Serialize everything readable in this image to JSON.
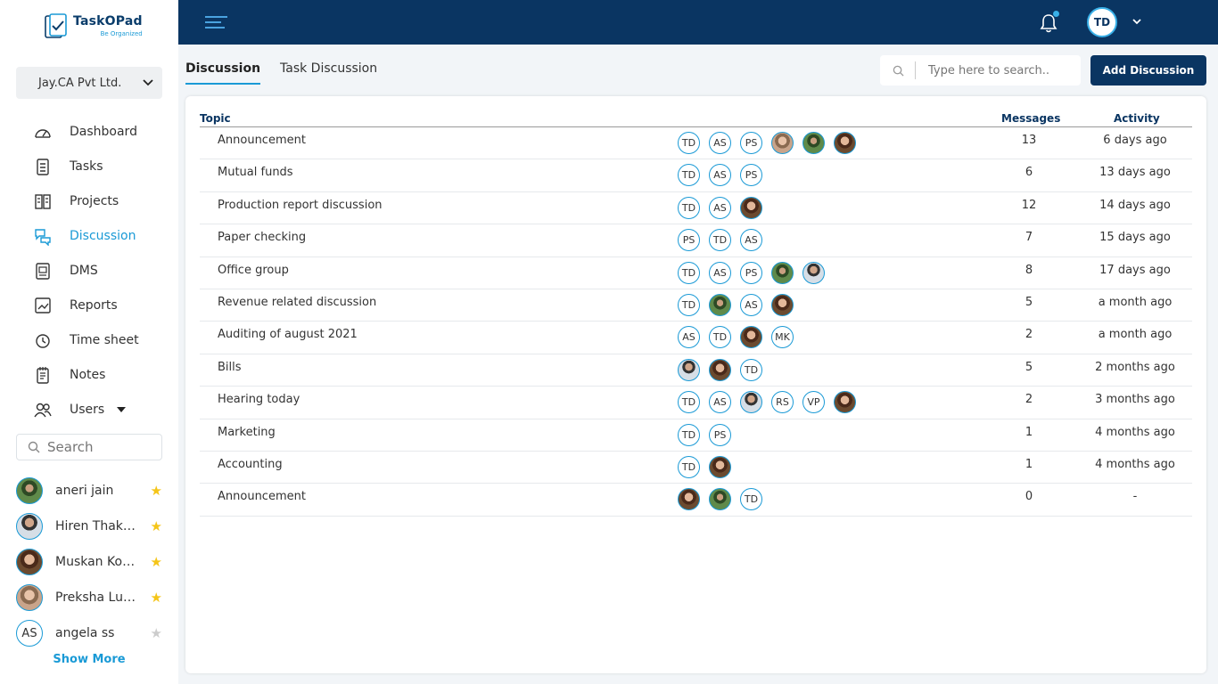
{
  "app": {
    "logo_name": "TaskOPad",
    "logo_tagline": "Be Organized",
    "company": "Jay.CA Pvt Ltd."
  },
  "nav": [
    {
      "label": "Dashboard",
      "icon": "dashboard-icon"
    },
    {
      "label": "Tasks",
      "icon": "tasks-icon"
    },
    {
      "label": "Projects",
      "icon": "projects-icon"
    },
    {
      "label": "Discussion",
      "icon": "discussion-icon",
      "active": true
    },
    {
      "label": "DMS",
      "icon": "dms-icon"
    },
    {
      "label": "Reports",
      "icon": "reports-icon"
    },
    {
      "label": "Time sheet",
      "icon": "timesheet-icon"
    },
    {
      "label": "Notes",
      "icon": "notes-icon"
    },
    {
      "label": "Users",
      "icon": "users-icon",
      "dropdown": true
    }
  ],
  "sidebar_search": {
    "placeholder": "Search"
  },
  "contacts": [
    {
      "name": "aneri jain",
      "avatar": "green",
      "starred": true
    },
    {
      "name": "Hiren Thakkar",
      "avatar": "male",
      "starred": true
    },
    {
      "name": "Muskan Kothari",
      "avatar": "female",
      "starred": true
    },
    {
      "name": "Preksha Lunawat",
      "avatar": "female2",
      "starred": true
    },
    {
      "name": "angela ss",
      "avatar": "AS",
      "starred": false
    }
  ],
  "show_more": "Show More",
  "header": {
    "user_initials": "TD"
  },
  "tabs": {
    "discussion": "Discussion",
    "task_discussion": "Task Discussion"
  },
  "search": {
    "placeholder": "Type here to search.."
  },
  "add_button": "Add Discussion",
  "table": {
    "col_topic": "Topic",
    "col_messages": "Messages",
    "col_activity": "Activity",
    "rows": [
      {
        "topic": "Announcement",
        "members": [
          "TD",
          "AS",
          "PS",
          "@female2",
          "@green",
          "@female"
        ],
        "messages": "13",
        "activity": "6 days ago"
      },
      {
        "topic": "Mutual funds",
        "members": [
          "TD",
          "AS",
          "PS"
        ],
        "messages": "6",
        "activity": "13 days ago"
      },
      {
        "topic": "Production report discussion",
        "members": [
          "TD",
          "AS",
          "@female"
        ],
        "messages": "12",
        "activity": "14 days ago"
      },
      {
        "topic": "Paper checking",
        "members": [
          "PS",
          "TD",
          "AS"
        ],
        "messages": "7",
        "activity": "15 days ago"
      },
      {
        "topic": "Office group",
        "members": [
          "TD",
          "AS",
          "PS",
          "@green",
          "@male"
        ],
        "messages": "8",
        "activity": "17 days ago"
      },
      {
        "topic": "Revenue related discussion",
        "members": [
          "TD",
          "@green",
          "AS",
          "@female"
        ],
        "messages": "5",
        "activity": "a month ago"
      },
      {
        "topic": "Auditing of august 2021",
        "members": [
          "AS",
          "TD",
          "@female",
          "MK"
        ],
        "messages": "2",
        "activity": "a month ago"
      },
      {
        "topic": "Bills",
        "members": [
          "@male",
          "@female",
          "TD"
        ],
        "messages": "5",
        "activity": "2 months ago"
      },
      {
        "topic": "Hearing today",
        "members": [
          "TD",
          "AS",
          "@male",
          "RS",
          "VP",
          "@female"
        ],
        "messages": "2",
        "activity": "3 months ago"
      },
      {
        "topic": "Marketing",
        "members": [
          "TD",
          "PS"
        ],
        "messages": "1",
        "activity": "4 months ago"
      },
      {
        "topic": "Accounting",
        "members": [
          "TD",
          "@female"
        ],
        "messages": "1",
        "activity": "4 months ago"
      },
      {
        "topic": "Announcement",
        "members": [
          "@female",
          "@green",
          "TD"
        ],
        "messages": "0",
        "activity": "-"
      }
    ]
  },
  "colors": {
    "navy": "#0a3562",
    "accent": "#1a9ad6",
    "star_on": "#f5c518",
    "star_off": "#cccccc"
  }
}
